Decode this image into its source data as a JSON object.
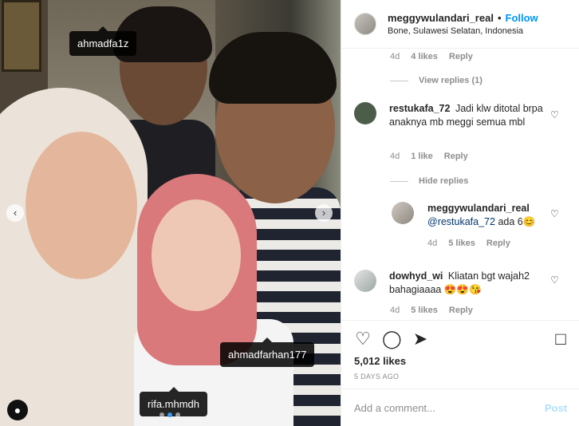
{
  "photo": {
    "tags": [
      "ahmadfa1z",
      "ahmadfarhan177",
      "rifa.mhmdh"
    ],
    "carousel_pages": 3,
    "carousel_active": 2
  },
  "header": {
    "username": "meggywulandari_real",
    "separator": "•",
    "follow": "Follow",
    "location": "Bone, Sulawesi Selatan, Indonesia"
  },
  "comments": {
    "top_actions": {
      "time": "4d",
      "likes": "4 likes",
      "reply": "Reply"
    },
    "view_replies": "View replies (1)",
    "c1": {
      "user": "restukafa_72",
      "text": "Jadi klw ditotal brpa anaknya mb meggi semua mbl",
      "time": "4d",
      "likes": "1 like",
      "reply": "Reply"
    },
    "hide_replies": "Hide replies",
    "r1": {
      "user": "meggywulandari_real",
      "mention": "@restukafa_72",
      "text": "ada 6😊",
      "time": "4d",
      "likes": "5 likes",
      "reply": "Reply"
    },
    "c2": {
      "user": "dowhyd_wi",
      "text": "Kliatan bgt wajah2 bahagiaaaa 😍😍😘",
      "time": "4d",
      "likes": "5 likes",
      "reply": "Reply"
    }
  },
  "actions": {
    "likes": "5,012 likes",
    "time": "5 DAYS AGO",
    "icons": [
      "heart-icon",
      "comment-icon",
      "share-icon",
      "bookmark-icon"
    ]
  },
  "add_comment": {
    "placeholder": "Add a comment...",
    "post": "Post"
  },
  "colors": {
    "link": "#0095f6",
    "post_disabled": "#b2dffc",
    "muted": "#8e8e8e"
  }
}
